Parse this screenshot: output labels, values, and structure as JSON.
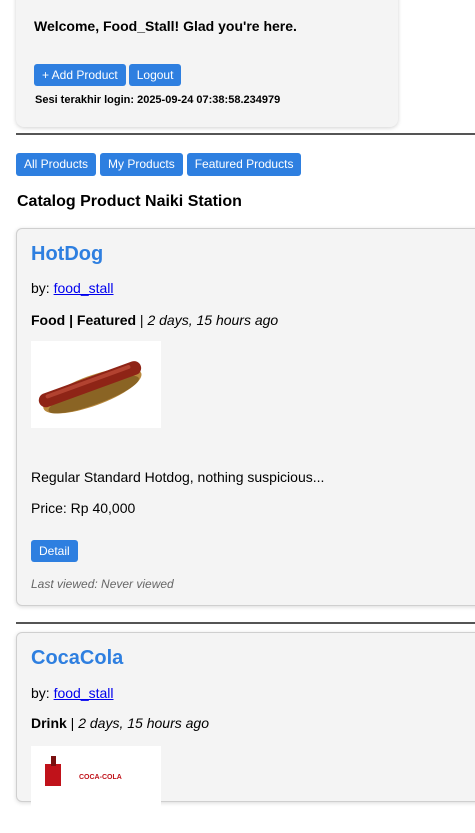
{
  "header": {
    "welcome": "Welcome, Food_Stall! Glad you're here.",
    "add_product_label": "+ Add Product",
    "logout_label": "Logout",
    "last_login": "Sesi terakhir login: 2025-09-24 07:38:58.234979"
  },
  "filters": {
    "all": "All Products",
    "mine": "My Products",
    "featured": "Featured Products"
  },
  "catalog_title": "Catalog Product Naiki Station",
  "products": [
    {
      "name": "HotDog",
      "by_prefix": "by:",
      "seller": "food_stall",
      "category_label": "Food | Featured",
      "separator": " | ",
      "time_ago": "2 days, 15 hours ago",
      "image": "hotdog-image",
      "description": "Regular Standard Hotdog, nothing suspicious...",
      "price": "Price: Rp 40,000",
      "detail_label": "Detail",
      "last_viewed": "Last viewed: Never viewed"
    },
    {
      "name": "CocaCola",
      "by_prefix": "by:",
      "seller": "food_stall",
      "category_label": "Drink",
      "separator": " | ",
      "time_ago": "2 days, 15 hours ago",
      "image": "cocacola-bottle-image",
      "image_text": "COCA-COLA"
    }
  ],
  "colors": {
    "accent": "#2e7fe0",
    "link": "#0000ee",
    "card_bg": "#f4f4f4"
  }
}
